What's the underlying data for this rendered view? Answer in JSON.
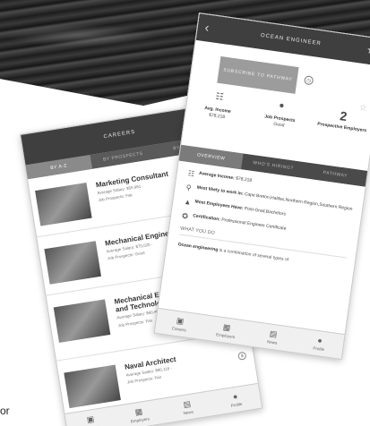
{
  "careers_screen": {
    "title": "CAREERS",
    "tabs": [
      {
        "label": "BY A-Z",
        "active": true
      },
      {
        "label": "BY PROSPECTS",
        "active": false
      },
      {
        "label": "BY SALARY",
        "active": false
      }
    ],
    "items": [
      {
        "title": "Marketing Consultant",
        "salary": "Average Salary: $59,981 -",
        "prospects": "Job Prospects: Fair"
      },
      {
        "title": "Mechanical Engineer",
        "salary": "Average Salary: $75,020 -",
        "prospects": "Job Prospects: Good"
      },
      {
        "title": "Mechanical Engineering Technician and Technologist",
        "salary": "Average Salary: $60,405 -",
        "prospects": "Job Prospects: Fair"
      },
      {
        "title": "Naval Architect",
        "salary": "Average Salary: $80,116 -",
        "prospects": "Job Prospects: Fair"
      }
    ]
  },
  "nav": [
    {
      "label": "Careers",
      "icon": "briefcase-icon"
    },
    {
      "label": "Employers",
      "icon": "building-icon"
    },
    {
      "label": "News",
      "icon": "book-icon"
    },
    {
      "label": "Profile",
      "icon": "person-icon"
    }
  ],
  "detail_screen": {
    "title": "OCEAN ENGINEER",
    "subscribe_label": "SUBSCRIBE TO PATHWAY",
    "stats": [
      {
        "label": "Avg. Income",
        "value": "$78,218"
      },
      {
        "label": "Job Prospects",
        "value": "Good"
      },
      {
        "label": "Prospective Employers",
        "value": "2"
      }
    ],
    "tabs": [
      {
        "label": "OVERVIEW",
        "active": true
      },
      {
        "label": "WHO'S HIRING?",
        "active": false
      },
      {
        "label": "PATHWAY",
        "active": false
      }
    ],
    "details": [
      {
        "label": "Average Income:",
        "value": "$78,218",
        "icon": "money-icon"
      },
      {
        "label": "Most likely to work in:",
        "value": "Cape Breton,Halifax,Northern Region,Southern Region",
        "icon": "location-pin-icon"
      },
      {
        "label": "Most Employees Have:",
        "value": "Post-Grad,Bachelors",
        "icon": "graduation-cap-icon"
      },
      {
        "label": "Certification:",
        "value": "Professional Engineer Certificate",
        "icon": "certificate-icon"
      }
    ],
    "what_you_do_heading": "WHAT YOU DO",
    "description_start": "Ocean engineering",
    "description_rest": " is a combination of several types of"
  },
  "partial_text": "or"
}
